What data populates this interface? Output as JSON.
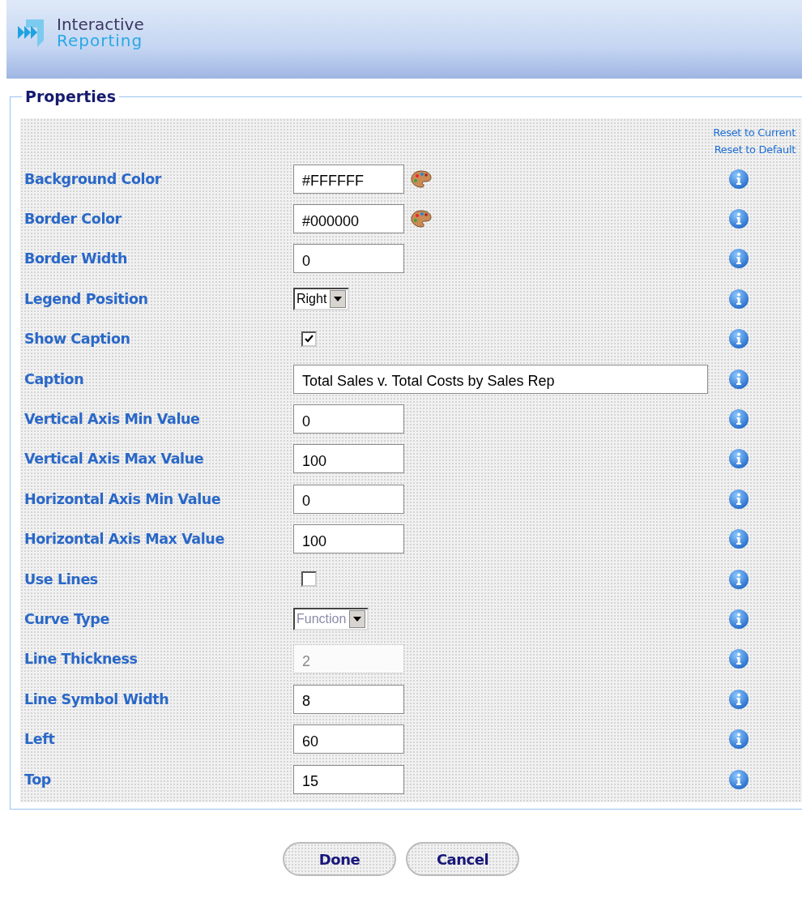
{
  "header": {
    "logo_line_1": "Interactive",
    "logo_line_2": "Reporting"
  },
  "panel": {
    "title": "Properties",
    "links": [
      "Reset to Current",
      "Reset to Default"
    ]
  },
  "properties": [
    {
      "label": "Background Color",
      "kind": "color",
      "value": "#FFFFFF",
      "disabled": false
    },
    {
      "label": "Border Color",
      "kind": "color",
      "value": "#000000",
      "disabled": false
    },
    {
      "label": "Border Width",
      "kind": "text",
      "value": "0",
      "disabled": false
    },
    {
      "label": "Legend Position",
      "kind": "select",
      "value": "Right",
      "disabled": false
    },
    {
      "label": "Show Caption",
      "kind": "checkbox",
      "checked": true
    },
    {
      "label": "Caption",
      "kind": "wide",
      "value": "Total Sales v. Total Costs by Sales Rep",
      "disabled": false
    },
    {
      "label": "Vertical Axis Min Value",
      "kind": "text",
      "value": "0",
      "disabled": false
    },
    {
      "label": "Vertical Axis Max Value",
      "kind": "text",
      "value": "100",
      "disabled": false
    },
    {
      "label": "Horizontal Axis Min Value",
      "kind": "text",
      "value": "0",
      "disabled": false
    },
    {
      "label": "Horizontal Axis Max Value",
      "kind": "text",
      "value": "100",
      "disabled": false
    },
    {
      "label": "Use Lines",
      "kind": "checkbox",
      "checked": false
    },
    {
      "label": "Curve Type",
      "kind": "select",
      "value": "Function",
      "disabled": true
    },
    {
      "label": "Line Thickness",
      "kind": "text",
      "value": "2",
      "disabled": true
    },
    {
      "label": "Line Symbol Width",
      "kind": "text",
      "value": "8",
      "disabled": false
    },
    {
      "label": "Left",
      "kind": "text",
      "value": "60",
      "disabled": false
    },
    {
      "label": "Top",
      "kind": "text",
      "value": "15",
      "disabled": false
    }
  ],
  "buttons": [
    "Done",
    "Cancel"
  ]
}
